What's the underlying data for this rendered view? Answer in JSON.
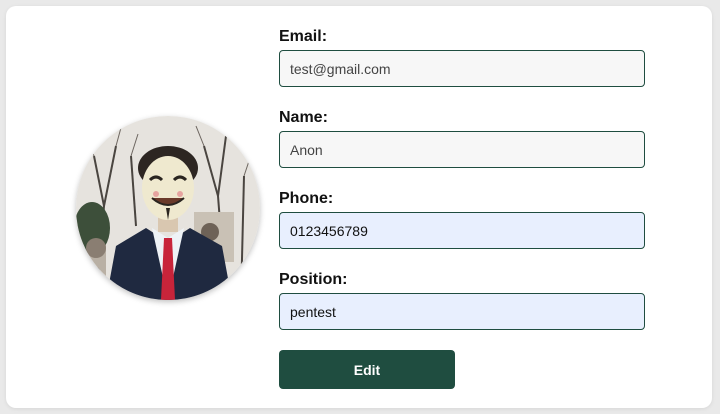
{
  "profile": {
    "avatar_alt": "profile photo",
    "fields": {
      "email": {
        "label": "Email:",
        "value": "test@gmail.com"
      },
      "name": {
        "label": "Name:",
        "value": "Anon"
      },
      "phone": {
        "label": "Phone:",
        "value": "0123456789"
      },
      "position": {
        "label": "Position:",
        "value": "pentest"
      }
    },
    "edit_label": "Edit"
  },
  "colors": {
    "accent": "#1f4d40",
    "readonly_bg": "#f7f7f7",
    "editable_bg": "#e8effe"
  }
}
